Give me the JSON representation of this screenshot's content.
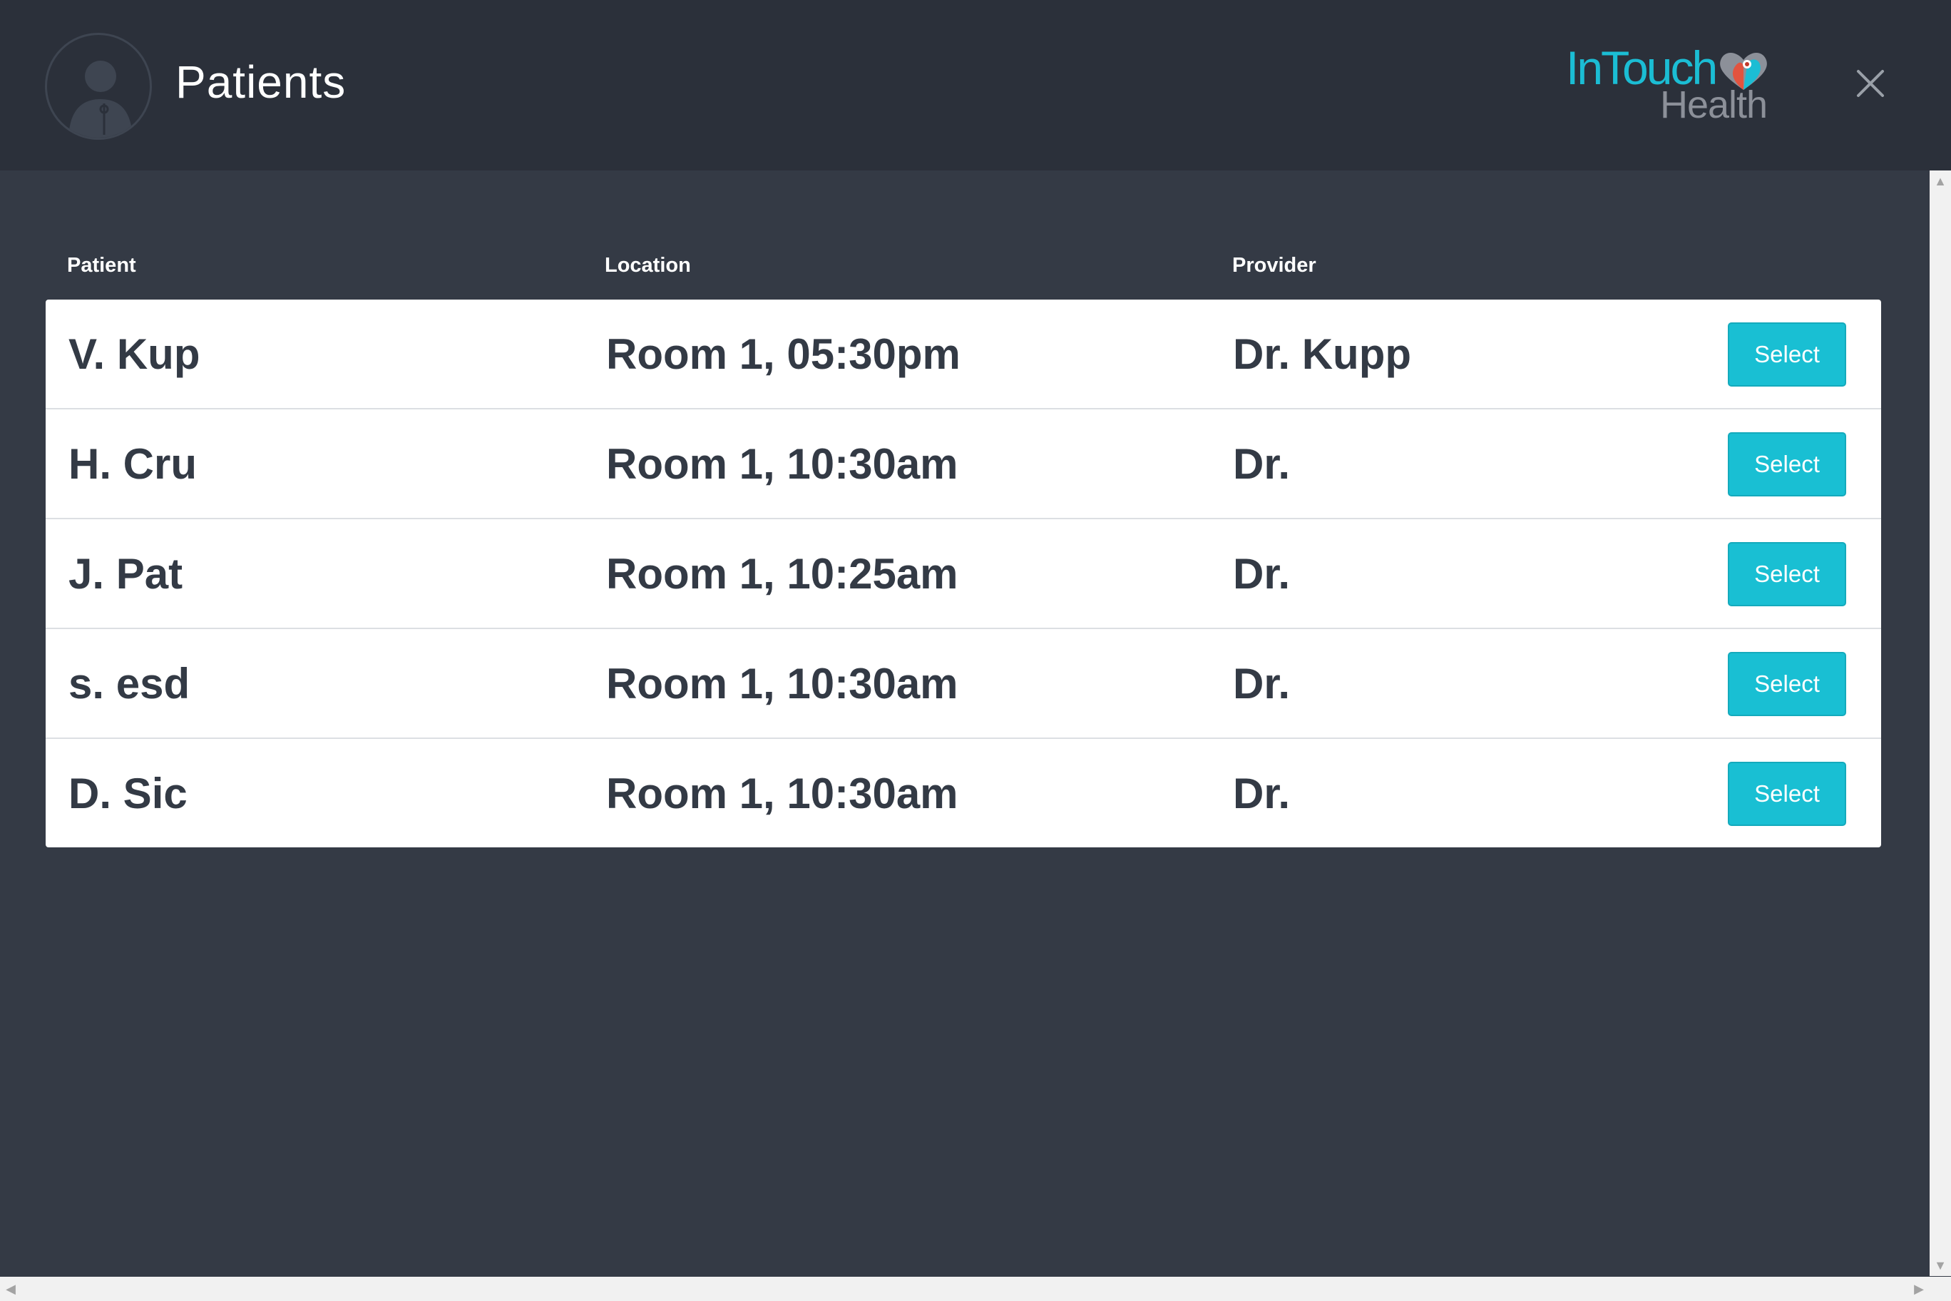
{
  "header": {
    "title": "Patients",
    "avatar_icon": "user-avatar-icon",
    "logo": {
      "line1": "InTouch",
      "line2": "Health"
    },
    "close_icon": "close-icon"
  },
  "columns": {
    "patient": "Patient",
    "location": "Location",
    "provider": "Provider"
  },
  "rows": [
    {
      "patient": "V. Kup",
      "location": "Room 1, 05:30pm",
      "provider": "Dr. Kupp",
      "action": "Select"
    },
    {
      "patient": "H. Cru",
      "location": "Room 1, 10:30am",
      "provider": "Dr.",
      "action": "Select"
    },
    {
      "patient": "J. Pat",
      "location": "Room 1, 10:25am",
      "provider": "Dr.",
      "action": "Select"
    },
    {
      "patient": "s. esd",
      "location": "Room 1, 10:30am",
      "provider": "Dr.",
      "action": "Select"
    },
    {
      "patient": "D. Sic",
      "location": "Room 1, 10:30am",
      "provider": "Dr.",
      "action": "Select"
    }
  ],
  "colors": {
    "header_bg": "#2b303a",
    "page_bg": "#343a45",
    "accent": "#19bfd3",
    "text_dark": "#333a45"
  }
}
